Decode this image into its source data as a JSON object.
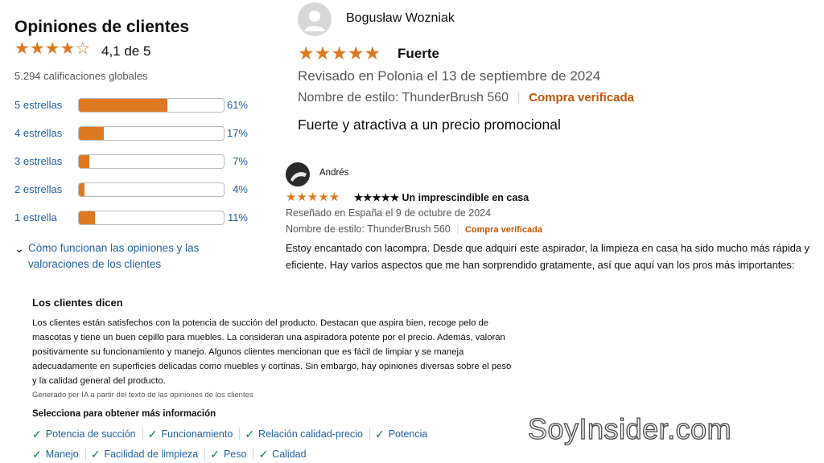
{
  "summary": {
    "title": "Opiniones de clientes",
    "rating_text": "4,1 de 5",
    "rating_value": 4.1,
    "global_ratings": "5.294 calificaciones globales",
    "rows": [
      {
        "label": "5 estrellas",
        "pct": "61%",
        "fraction": 0.61
      },
      {
        "label": "4 estrellas",
        "pct": "17%",
        "fraction": 0.17
      },
      {
        "label": "3 estrellas",
        "pct": "7%",
        "fraction": 0.07
      },
      {
        "label": "2 estrellas",
        "pct": "4%",
        "fraction": 0.04
      },
      {
        "label": "1 estrella",
        "pct": "11%",
        "fraction": 0.11
      }
    ],
    "how_link": "Cómo funcionan las opiniones y las valoraciones de los clientes"
  },
  "review1": {
    "author": "Bogusław Wozniak",
    "stars": "★★★★★",
    "title": "Fuerte",
    "meta": "Revisado en Polonia el 13 de septiembre de 2024",
    "style": "Nombre de estilo: ThunderBrush 560",
    "verified": "Compra verificada",
    "body": "Fuerte y atractiva a un precio promocional"
  },
  "review2": {
    "author": "Andrés",
    "stars": "★★★★★",
    "title": "★★★★★ Un imprescindible en casa",
    "meta": "Reseñado en España el 9 de octubre de 2024",
    "style": "Nombre de estilo: ThunderBrush 560",
    "verified": "Compra verificada",
    "body": "Estoy encantado con lacompra. Desde que adquirí este aspirador, la limpieza en casa ha sido mucho más rápida y eficiente. Hay varios aspectos que me han sorprendido gratamente, así que aquí van los pros más importantes:"
  },
  "customers_say": {
    "heading": "Los clientes dicen",
    "text": "Los clientes están satisfechos con la potencia de succión del producto. Destacan que aspira bien, recoge pelo de mascotas y tiene un buen cepillo para muebles. La consideran una aspiradora potente por el precio. Además, valoran positivamente su funcionamiento y manejo. Algunos clientes mencionan que es fácil de limpiar y se maneja adecuadamente en superficies delicadas como muebles y cortinas. Sin embargo, hay opiniones diversas sobre el peso y la calidad general del producto.",
    "ai_note": "Generado por IA a partir del texto de las opiniones de los clientes",
    "select_label": "Selecciona para obtener más información",
    "chips_row1": [
      "Potencia de succión",
      "Funcionamiento",
      "Relación calidad-precio",
      "Potencia"
    ],
    "chips_row2": [
      "Manejo",
      "Facilidad de limpieza",
      "Peso",
      "Calidad"
    ]
  },
  "watermark": "SoyInsider.com",
  "colors": {
    "star": "#de7921",
    "link": "#2162a1",
    "verified": "#c45500",
    "check": "#067d62"
  }
}
